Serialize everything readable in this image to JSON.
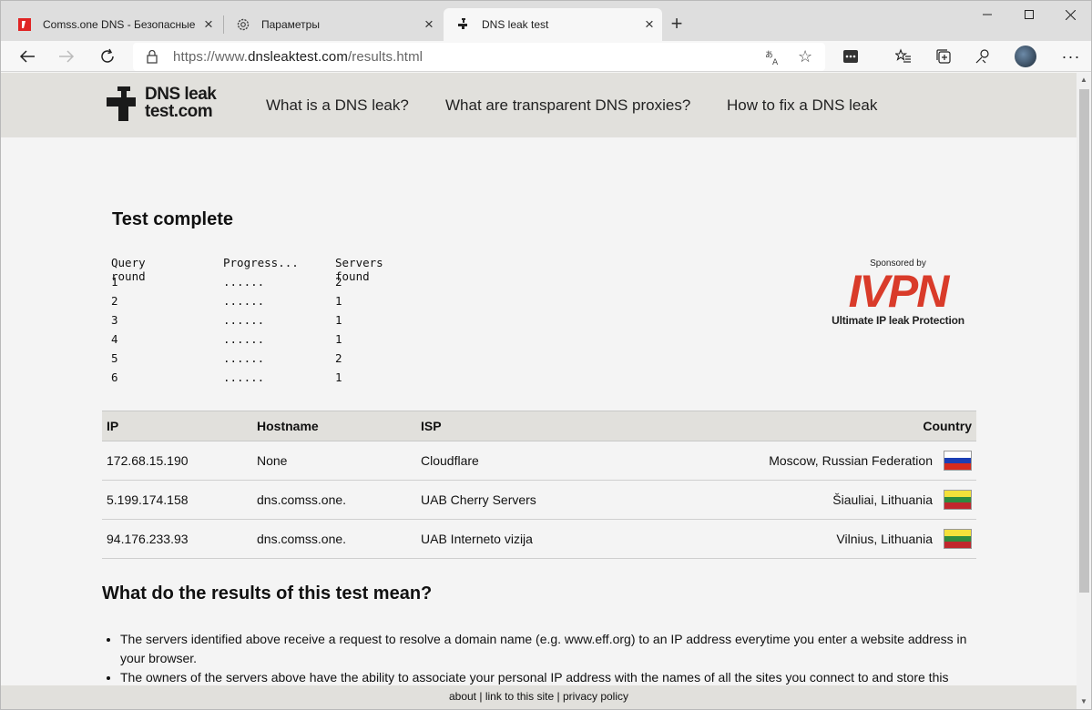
{
  "browser": {
    "tabs": [
      {
        "title": "Comss.one DNS - Безопасные DNS",
        "favicon": "comss-red-icon",
        "active": false
      },
      {
        "title": "Параметры",
        "favicon": "gear-icon",
        "active": false
      },
      {
        "title": "DNS leak test",
        "favicon": "faucet-icon",
        "active": true
      }
    ],
    "address": {
      "prefix": "https://www.",
      "host": "dnsleaktest.com",
      "path": "/results.html"
    }
  },
  "site": {
    "logo_line1": "DNS leak",
    "logo_line2": "test.com",
    "nav": [
      "What is a DNS leak?",
      "What are transparent DNS proxies?",
      "How to fix a DNS leak"
    ]
  },
  "test": {
    "heading": "Test complete",
    "headers": [
      "Query round",
      "Progress...",
      "Servers found"
    ],
    "rounds": [
      {
        "round": "1",
        "progress": "......",
        "servers": "2"
      },
      {
        "round": "2",
        "progress": "......",
        "servers": "1"
      },
      {
        "round": "3",
        "progress": "......",
        "servers": "1"
      },
      {
        "round": "4",
        "progress": "......",
        "servers": "1"
      },
      {
        "round": "5",
        "progress": "......",
        "servers": "2"
      },
      {
        "round": "6",
        "progress": "......",
        "servers": "1"
      }
    ]
  },
  "sponsor": {
    "by": "Sponsored by",
    "brand": "IVPN",
    "tagline": "Ultimate IP leak Protection",
    "brand_color": "#d93b2a"
  },
  "results": {
    "headers": {
      "ip": "IP",
      "hostname": "Hostname",
      "isp": "ISP",
      "country": "Country"
    },
    "rows": [
      {
        "ip": "172.68.15.190",
        "hostname": "None",
        "isp": "Cloudflare",
        "country": "Moscow, Russian Federation",
        "flag": "russia-flag-icon"
      },
      {
        "ip": "5.199.174.158",
        "hostname": "dns.comss.one.",
        "isp": "UAB Cherry Servers",
        "country": "Šiauliai, Lithuania",
        "flag": "lithuania-flag-icon"
      },
      {
        "ip": "94.176.233.93",
        "hostname": "dns.comss.one.",
        "isp": "UAB Interneto vizija",
        "country": "Vilnius, Lithuania",
        "flag": "lithuania-flag-icon"
      }
    ]
  },
  "explanation": {
    "heading": "What do the results of this test mean?",
    "items": [
      "The servers identified above receive a request to resolve a domain name (e.g. www.eff.org) to an IP address everytime you enter a website address in your browser.",
      "The owners of the servers above have the ability to associate your personal IP address with the names of all the sites you connect to and store this"
    ]
  },
  "footer": {
    "about": "about",
    "link": "link to this site",
    "privacy": "privacy policy",
    "separator": " | "
  }
}
